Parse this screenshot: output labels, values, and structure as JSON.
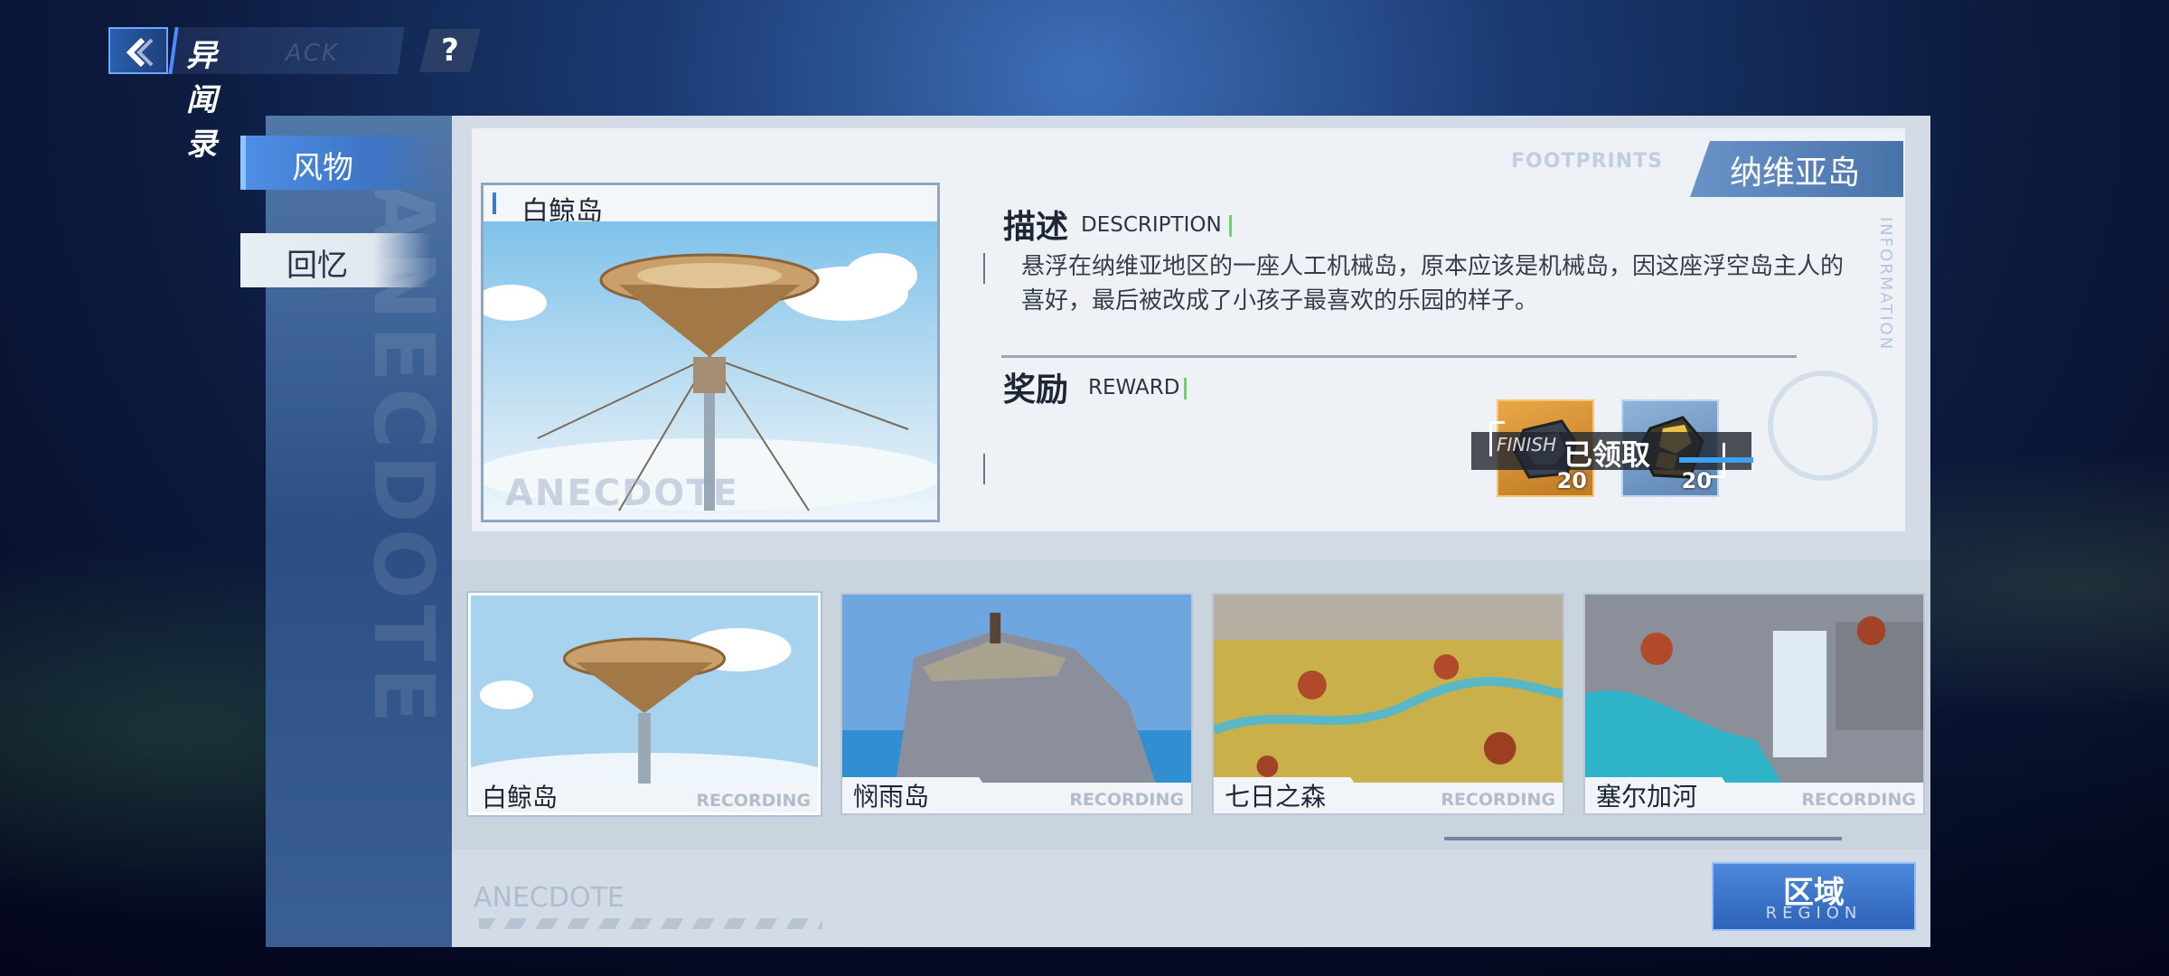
{
  "header": {
    "title": "异闻录",
    "ghost_text": "ACK",
    "help_label": "?"
  },
  "sidebar": {
    "items": [
      {
        "label": "风物",
        "active": true
      },
      {
        "label": "回忆",
        "active": false
      }
    ],
    "watermark": "ANECDOTE"
  },
  "region_tag": "纳维亚岛",
  "decor": {
    "footprints": "FOOTPRINTS",
    "information": "INFORMATION"
  },
  "featured": {
    "title": "白鲸岛",
    "watermark": "ANECDOTE"
  },
  "description": {
    "heading": "描述",
    "sub": "DESCRIPTION",
    "text": "悬浮在纳维亚地区的一座人工机械岛，原本应该是机械岛，因这座浮空岛主人的喜好，最后被改成了小孩子最喜欢的乐园的样子。"
  },
  "reward": {
    "heading": "奖励",
    "sub": "REWARD",
    "items": [
      {
        "icon": "gear-material-icon",
        "count": "20"
      },
      {
        "icon": "gold-ore-icon",
        "count": "20"
      }
    ],
    "claimed_label": "已领取",
    "finish_label": "FINISH"
  },
  "thumbnails": [
    {
      "name": "白鲸岛",
      "tag": "RECORDING",
      "selected": true
    },
    {
      "name": "悯雨岛",
      "tag": "RECORDING",
      "selected": false
    },
    {
      "name": "七日之森",
      "tag": "RECORDING",
      "selected": false
    },
    {
      "name": "塞尔加河",
      "tag": "RECORDING",
      "selected": false
    }
  ],
  "footer": {
    "watermark": "ANECDOTE",
    "region_button": {
      "label": "区域",
      "sub": "REGION"
    }
  },
  "colors": {
    "accent_blue": "#3a7bd5",
    "panel_bg": "#d3dce6",
    "reward_gold": "#e8a747",
    "reward_blue": "#8fb4d8"
  }
}
